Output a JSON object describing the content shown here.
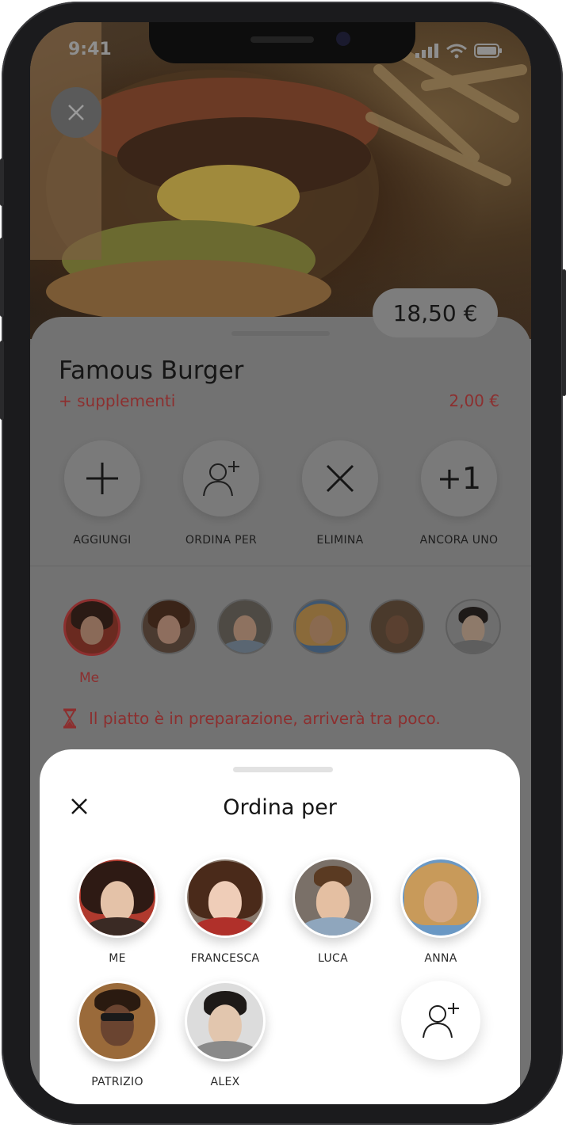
{
  "status": {
    "time": "9:41"
  },
  "product": {
    "price": "18,50 €",
    "name": "Famous Burger",
    "supplements_label": "+ supplementi",
    "supplements_price": "2,00 €"
  },
  "actions": [
    {
      "icon": "plus-icon",
      "label": "AGGIUNGI"
    },
    {
      "icon": "add-person-icon",
      "label": "ORDINA PER"
    },
    {
      "icon": "close-icon",
      "label": "ELIMINA"
    },
    {
      "icon": "plus-one-icon",
      "label": "ANCORA UNO",
      "glyph": "+1"
    }
  ],
  "diners": {
    "selected_label": "Me"
  },
  "status_message": "Il piatto è in preparazione, arriverà tra poco.",
  "sheet": {
    "title": "Ordina per",
    "people": [
      {
        "name": "ME"
      },
      {
        "name": "FRANCESCA"
      },
      {
        "name": "LUCA"
      },
      {
        "name": "ANNA"
      },
      {
        "name": "PATRIZIO"
      },
      {
        "name": "ALEX"
      }
    ]
  },
  "colors": {
    "accent": "#c0392b",
    "overlay": "#6c6c6c",
    "sheet": "#ffffff"
  }
}
